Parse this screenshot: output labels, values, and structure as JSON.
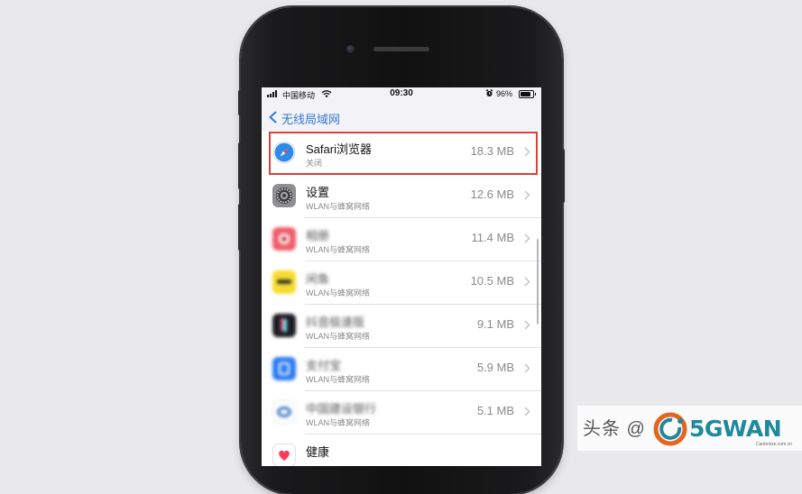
{
  "status_bar": {
    "carrier": "中国移动",
    "time": "09:30",
    "battery": "96%"
  },
  "nav": {
    "back_label": "无线局域网"
  },
  "apps": [
    {
      "name": "Safari浏览器",
      "sub": "关闭",
      "size": "18.3 MB",
      "icon": "safari-compass-icon",
      "color": "#2f8bea",
      "blurred": false
    },
    {
      "name": "设置",
      "sub": "WLAN与蜂窝网络",
      "size": "12.6 MB",
      "icon": "settings-gear-icon",
      "color": "#8e8e93",
      "blurred": false
    },
    {
      "name": "相册",
      "sub": "WLAN与蜂窝网络",
      "size": "11.4 MB",
      "icon": "app-icon",
      "color": "#ef5e6a",
      "blurred": true
    },
    {
      "name": "闲鱼",
      "sub": "WLAN与蜂窝网络",
      "size": "10.5 MB",
      "icon": "app-icon",
      "color": "#f6dc2e",
      "blurred": true
    },
    {
      "name": "抖音极速版",
      "sub": "WLAN与蜂窝网络",
      "size": "9.1 MB",
      "icon": "app-icon",
      "color": "#1c1c22",
      "blurred": true
    },
    {
      "name": "支付宝",
      "sub": "WLAN与蜂窝网络",
      "size": "5.9 MB",
      "icon": "app-icon",
      "color": "#2e7cf1",
      "blurred": true
    },
    {
      "name": "中国建设银行",
      "sub": "WLAN与蜂窝网络",
      "size": "5.1 MB",
      "icon": "app-icon",
      "color": "#3a74c4",
      "blurred": true
    },
    {
      "name": "健康",
      "sub": "",
      "size": "",
      "icon": "health-heart-icon",
      "color": "#ffffff",
      "blurred": false
    }
  ],
  "watermark": {
    "prefix": "头条 @",
    "brand": "5GWAN",
    "sub": "Cantonize.com.cn"
  },
  "colors": {
    "accent": "#3478d8",
    "highlight": "#d94038",
    "brand": "#1d8a9e"
  }
}
